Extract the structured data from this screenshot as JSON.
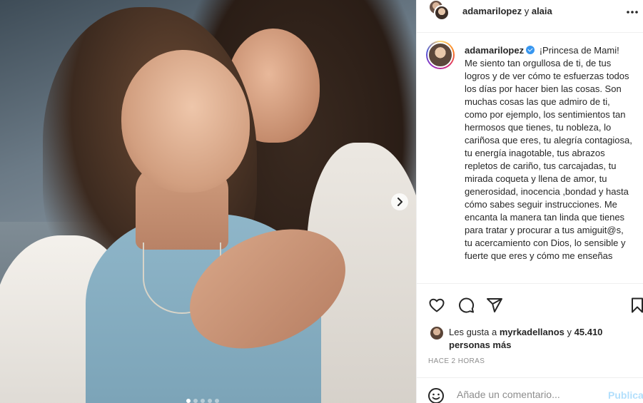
{
  "header": {
    "user1": "adamarilopez",
    "connector": "y",
    "user2": "alaia"
  },
  "caption": {
    "username": "adamarilopez",
    "text": "¡Princesa de Mami! Me siento tan orgullosa de ti, de tus logros y de ver cómo te esfuerzas todos los días por hacer bien las cosas. Son muchas cosas las que admiro de ti, como por ejemplo, los sentimientos tan hermosos que tienes, tu nobleza, lo cariñosa que eres, tu alegría contagiosa, tu energía inagotable, tus abrazos repletos de cariño, tus carcajadas, tu mirada coqueta y llena de amor, tu generosidad, inocencia ,bondad y hasta cómo sabes seguir instrucciones. Me encanta la manera tan linda que tienes para tratar y procurar a tus amiguit@s, tu acercamiento con Dios, lo sensible y fuerte que eres y cómo me enseñas"
  },
  "likes": {
    "prefix": "Les gusta a",
    "user": "myrkadellanos",
    "connector": "y",
    "count": "45.410 personas más"
  },
  "time": "HACE 2 HORAS",
  "comment": {
    "placeholder": "Añade un comentario...",
    "publish": "Publicar"
  },
  "carousel": {
    "total_slides": 5,
    "active_index": 0
  },
  "icons": {
    "header": [
      "more-options-icon"
    ],
    "photo": [
      "chevron-right-icon"
    ],
    "actions": [
      "heart-icon",
      "comment-icon",
      "share-icon",
      "bookmark-icon"
    ],
    "comment": [
      "emoji-icon"
    ]
  },
  "colors": {
    "verified": "#3897f0",
    "publish_disabled": "#b2dffc",
    "secondary_text": "#8e8e8e"
  }
}
